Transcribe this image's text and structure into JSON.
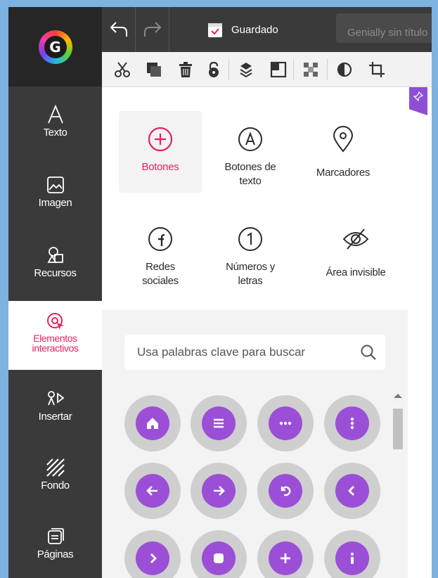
{
  "app": {
    "logo_letter": "G"
  },
  "sidebar": {
    "items": [
      {
        "label": "Texto",
        "icon": "text-icon"
      },
      {
        "label": "Imagen",
        "icon": "image-icon"
      },
      {
        "label": "Recursos",
        "icon": "resources-icon"
      },
      {
        "label_line1": "Elementos",
        "label_line2": "interactivos",
        "icon": "interactive-cursor-icon",
        "active": true
      },
      {
        "label": "Insertar",
        "icon": "insert-icon"
      },
      {
        "label": "Fondo",
        "icon": "background-icon"
      },
      {
        "label": "Páginas",
        "icon": "pages-icon"
      }
    ]
  },
  "topbar": {
    "undo_icon": "undo-icon",
    "redo_icon": "redo-icon",
    "saved_label": "Guardado",
    "title_value": "Genially sin título"
  },
  "toolbar": {
    "tools": [
      "cut-icon",
      "duplicate-icon",
      "delete-icon",
      "lock-icon",
      "layers-icon",
      "arrange-icon",
      "transparency-icon",
      "color-icon",
      "crop-icon"
    ]
  },
  "panel": {
    "categories": [
      {
        "label": "Botones",
        "icon": "plus-circle-icon",
        "selected": true
      },
      {
        "label_line1": "Botones de",
        "label_line2": "texto",
        "icon": "text-button-icon"
      },
      {
        "label": "Marcadores",
        "icon": "map-marker-icon"
      },
      {
        "label_line1": "Redes",
        "label_line2": "sociales",
        "icon": "facebook-icon"
      },
      {
        "label_line1": "Números y",
        "label_line2": "letras",
        "icon": "number-one-icon"
      },
      {
        "label": "Área invisible",
        "icon": "eye-off-icon"
      }
    ],
    "search": {
      "placeholder": "Usa palabras clave para buscar"
    },
    "buttons": [
      "home-icon",
      "menu-icon",
      "more-horizontal-icon",
      "more-vertical-icon",
      "arrow-left-icon",
      "arrow-right-icon",
      "undo-circle-icon",
      "chevron-left-icon",
      "chevron-right-icon",
      "stop-icon",
      "plus-icon",
      "info-icon"
    ]
  },
  "colors": {
    "accent_pink": "#e8205f",
    "button_purple": "#9b4fd6",
    "sidebar_bg": "#3a3a3a"
  }
}
